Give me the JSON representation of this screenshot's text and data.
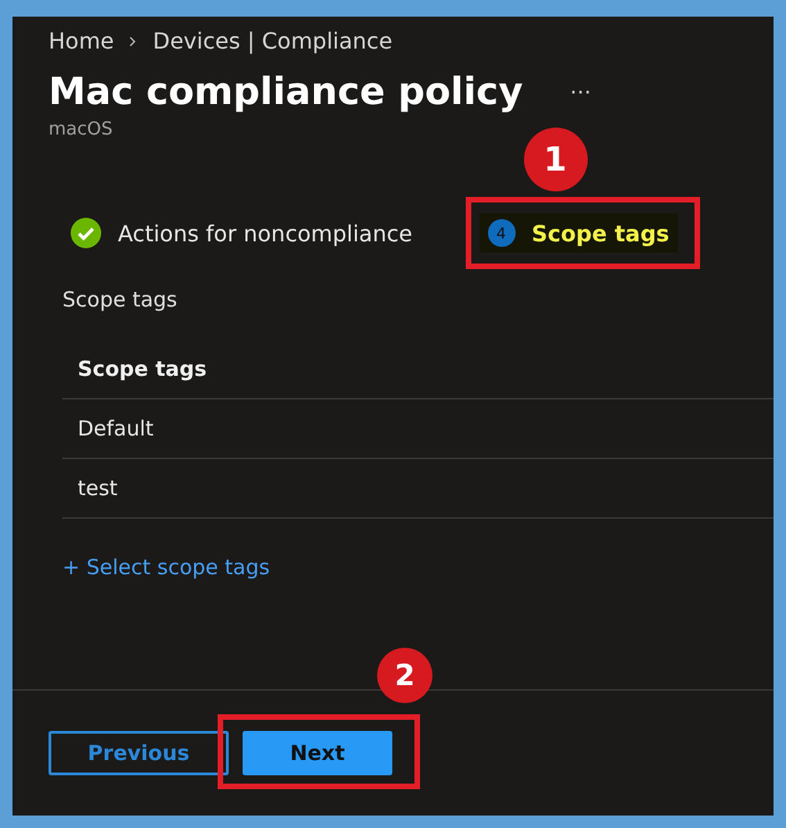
{
  "breadcrumb": [
    "Home",
    "Devices | Compliance"
  ],
  "title": "Mac compliance policy",
  "more": "···",
  "subtitle": "macOS",
  "steps": [
    {
      "kind": "completed",
      "label": "Actions for noncompliance",
      "selected": false
    },
    {
      "kind": "numbered",
      "number": "4",
      "label": "Scope tags",
      "selected": true,
      "callout": "1"
    }
  ],
  "section_label": "Scope tags",
  "table": {
    "columns": [
      "Scope tags"
    ],
    "rows": [
      [
        "Default"
      ],
      [
        "test"
      ]
    ]
  },
  "add_link": "+ Select scope tags",
  "buttons": [
    {
      "label": "Previous",
      "kind": "secondary"
    },
    {
      "label": "Next",
      "kind": "primary",
      "callout": "2"
    }
  ]
}
